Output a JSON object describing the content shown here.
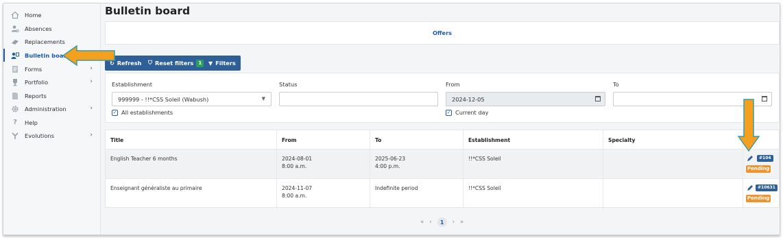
{
  "sidebar": {
    "items": [
      {
        "label": "Home",
        "icon": "home-icon",
        "chevron": ""
      },
      {
        "label": "Absences",
        "icon": "absence-user-icon",
        "chevron": ""
      },
      {
        "label": "Replacements",
        "icon": "replace-icon",
        "chevron": ""
      },
      {
        "label": "Bulletin board",
        "icon": "bulletin-board-icon",
        "chevron": ""
      },
      {
        "label": "Forms",
        "icon": "forms-icon",
        "chevron": "›"
      },
      {
        "label": "Portfolio",
        "icon": "trophy-icon",
        "chevron": "›"
      },
      {
        "label": "Reports",
        "icon": "reports-icon",
        "chevron": ""
      },
      {
        "label": "Administration",
        "icon": "gear-icon",
        "chevron": "›"
      },
      {
        "label": "Help",
        "icon": "help-icon",
        "chevron": ""
      },
      {
        "label": "Evolutions",
        "icon": "evolutions-icon",
        "chevron": "›"
      }
    ]
  },
  "page": {
    "title": "Bulletin board",
    "offers_label": "Offers"
  },
  "toolbar": {
    "refresh_label": "Refresh",
    "reset_label": "Reset filters",
    "reset_count": "1",
    "filters_label": "Filters"
  },
  "filters": {
    "establishment_label": "Establishment",
    "establishment_value": "999999 - !!*CSS Soleil (Wabush)",
    "all_establishments_label": "All establishments",
    "status_label": "Status",
    "status_value": "",
    "from_label": "From",
    "from_value": "2024-12-05",
    "current_day_label": "Current day",
    "to_label": "To",
    "to_value": ""
  },
  "table": {
    "headers": [
      "Title",
      "From",
      "To",
      "Establishment",
      "Specialty"
    ],
    "rows": [
      {
        "title": "English Teacher 6 months",
        "from_date": "2024-08-01",
        "from_time": "8:00 a.m.",
        "to_date": "2025-06-23",
        "to_time": "4:00 p.m.",
        "establishment": "!!*CSS Soleil",
        "specialty": "",
        "number": "#104",
        "status": "Pending"
      },
      {
        "title": "Enseignant généraliste au primaire",
        "from_date": "2024-11-07",
        "from_time": "8:00 a.m.",
        "to_date": "Indefinite period",
        "to_time": "",
        "establishment": "!!*CSS Soleil",
        "specialty": "",
        "number": "#10631",
        "status": "Pending"
      }
    ]
  },
  "pagination": {
    "first": "«",
    "prev": "‹",
    "current": "1",
    "next": "›",
    "last": "»"
  },
  "colors": {
    "primary": "#2e5f97",
    "link": "#1d5aa8",
    "pending": "#f0932e",
    "annotation_arrow": "#f2a01e"
  }
}
